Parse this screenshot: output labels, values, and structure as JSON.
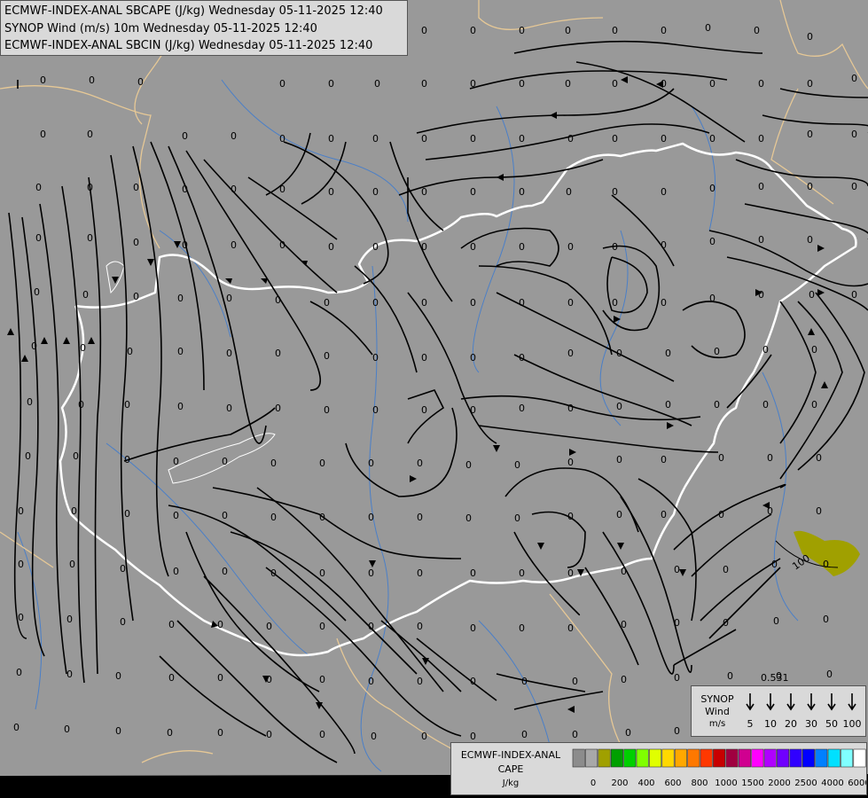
{
  "titles": {
    "line1": "ECMWF-INDEX-ANAL SBCAPE (J/kg) Wednesday 05-11-2025 12:40",
    "line2": "SYNOP Wind (m/s) 10m Wednesday 05-11-2025 12:40",
    "line3": "ECMWF-INDEX-ANAL SBCIN (J/kg) Wednesday 05-11-2025 12:40"
  },
  "synop_legend": {
    "title_line1": "SYNOP",
    "title_line2": "Wind",
    "unit": "m/s",
    "speeds": [
      "5",
      "10",
      "20",
      "30",
      "50",
      "100"
    ]
  },
  "cape_legend": {
    "title_line1": "ECMWF-INDEX-ANAL",
    "title_line2": "CAPE",
    "unit": "J/kg",
    "colors": [
      "#8c8c8c",
      "#a8a8a8",
      "#a0a000",
      "#00a000",
      "#00d000",
      "#80ff00",
      "#e0ff00",
      "#ffd800",
      "#ffa800",
      "#ff7800",
      "#ff3800",
      "#c80000",
      "#a00040",
      "#d00090",
      "#ff00ff",
      "#b000ff",
      "#7000ff",
      "#3000ff",
      "#0000ff",
      "#0080ff",
      "#00e0ff",
      "#80ffff",
      "#ffffff"
    ],
    "tick_labels": [
      "0",
      "200",
      "400",
      "600",
      "800",
      "1000",
      "1500",
      "2000",
      "2500",
      "4000",
      "6000"
    ]
  },
  "map_values": {
    "zero": "0",
    "sample_value": "0.531",
    "contour_label": "100"
  },
  "colors": {
    "background": "#999999",
    "border_country": "#ffffff",
    "border_region": "#e6c896",
    "rivers": "#4a7fc8",
    "streamline": "#000000",
    "cape_patch": "#a0a000"
  }
}
